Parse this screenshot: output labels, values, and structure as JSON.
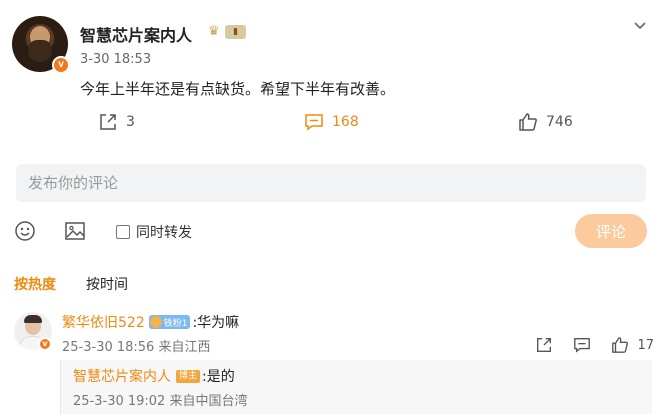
{
  "post": {
    "author": "智慧芯片案内人",
    "time": "3-30 18:53",
    "text": "今年上半年还是有点缺货。希望下半年有改善。",
    "shares": "3",
    "comments": "168",
    "likes": "746"
  },
  "composer": {
    "placeholder": "发布你的评论",
    "repost_label": "同时转发",
    "submit_label": "评论"
  },
  "sort": {
    "hot": "按热度",
    "time": "按时间"
  },
  "comments": [
    {
      "user": "繁华依旧522",
      "fan_badge": "铁粉1",
      "text": ":华为嘛",
      "meta": "25-3-30 18:56 来自江西",
      "likes": "17",
      "replies": [
        {
          "user": "智慧芯片案内人",
          "badge": "博主",
          "text": ":是的",
          "meta": "25-3-30 19:02 来自中国台湾"
        }
      ]
    }
  ],
  "colors": {
    "accent": "#ee8a12",
    "submit_disabled": "#fbcb9e",
    "input_bg": "#f2f3f5"
  }
}
